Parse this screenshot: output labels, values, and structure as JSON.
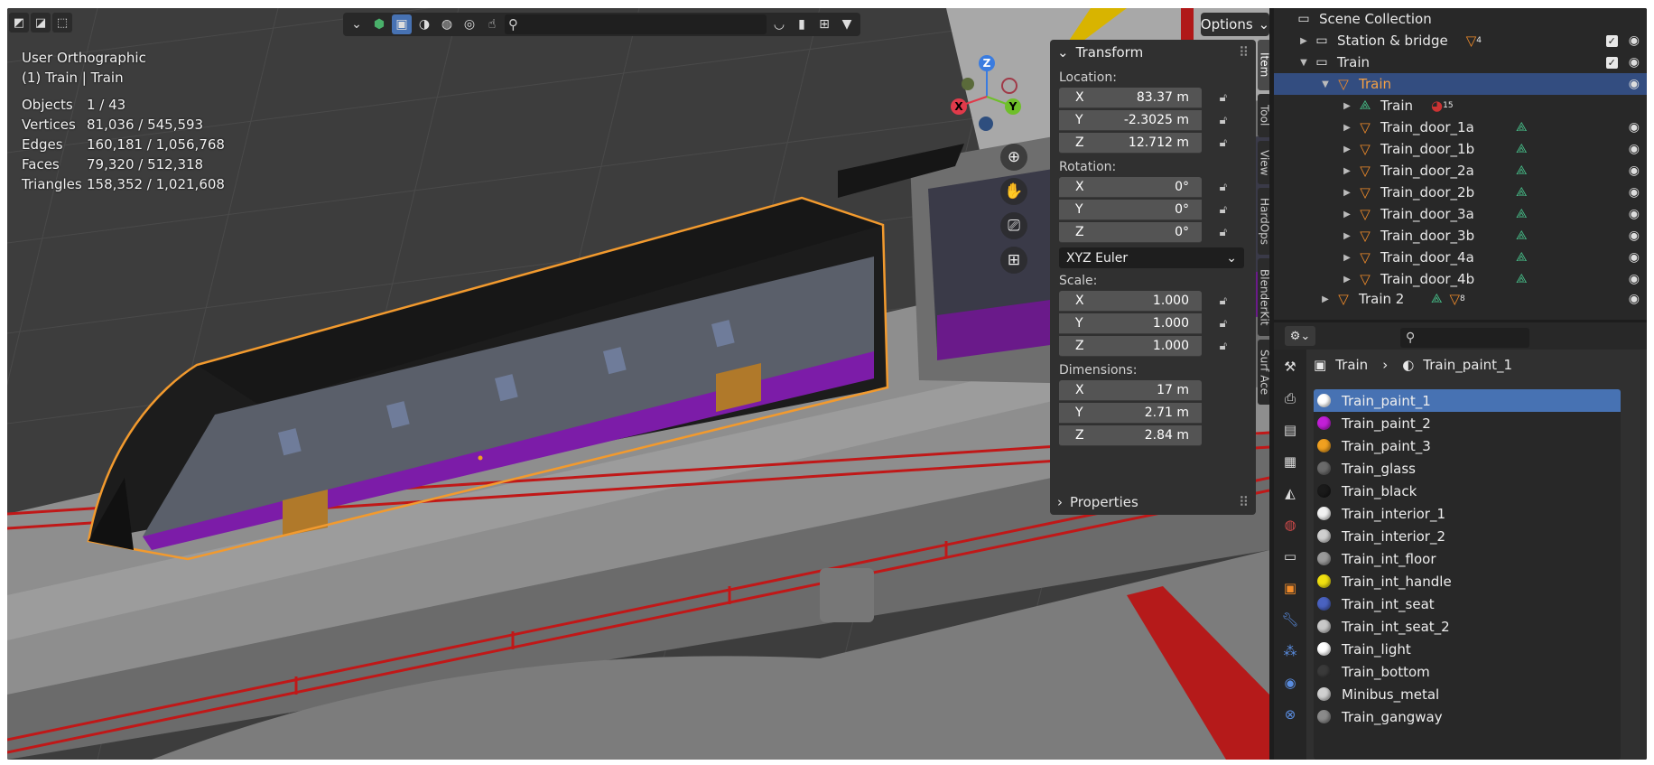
{
  "viewport": {
    "view_name": "User Orthographic",
    "active_object": "(1) Train | Train",
    "stats": [
      {
        "label": "Objects",
        "value": "1 / 43"
      },
      {
        "label": "Vertices",
        "value": "81,036 / 545,593"
      },
      {
        "label": "Edges",
        "value": "160,181 / 1,056,768"
      },
      {
        "label": "Faces",
        "value": "79,320 / 512,318"
      },
      {
        "label": "Triangles",
        "value": "158,352 / 1,021,608"
      }
    ],
    "options_label": "Options",
    "gizmo": {
      "x": "X",
      "y": "Y",
      "z": "Z"
    }
  },
  "npanel": {
    "transform_title": "Transform",
    "location_label": "Location:",
    "location": [
      {
        "axis": "X",
        "value": "83.37 m"
      },
      {
        "axis": "Y",
        "value": "-2.3025 m"
      },
      {
        "axis": "Z",
        "value": "12.712 m"
      }
    ],
    "rotation_label": "Rotation:",
    "rotation": [
      {
        "axis": "X",
        "value": "0°"
      },
      {
        "axis": "Y",
        "value": "0°"
      },
      {
        "axis": "Z",
        "value": "0°"
      }
    ],
    "rotation_mode": "XYZ Euler",
    "scale_label": "Scale:",
    "scale": [
      {
        "axis": "X",
        "value": "1.000"
      },
      {
        "axis": "Y",
        "value": "1.000"
      },
      {
        "axis": "Z",
        "value": "1.000"
      }
    ],
    "dimensions_label": "Dimensions:",
    "dimensions": [
      {
        "axis": "X",
        "value": "17 m"
      },
      {
        "axis": "Y",
        "value": "2.71 m"
      },
      {
        "axis": "Z",
        "value": "2.84 m"
      }
    ],
    "properties_title": "Properties",
    "tabs": [
      "Item",
      "Tool",
      "View",
      "HardOps",
      "BlenderKit",
      "Surf Ace"
    ]
  },
  "outliner": {
    "scene_collection": "Scene Collection",
    "rows": [
      {
        "label": "Station & bridge",
        "badge": "4"
      },
      {
        "label": "Train"
      },
      {
        "label": "Train"
      },
      {
        "label": "Train",
        "badge": "15"
      },
      {
        "label": "Train_door_1a"
      },
      {
        "label": "Train_door_1b"
      },
      {
        "label": "Train_door_2a"
      },
      {
        "label": "Train_door_2b"
      },
      {
        "label": "Train_door_3a"
      },
      {
        "label": "Train_door_3b"
      },
      {
        "label": "Train_door_4a"
      },
      {
        "label": "Train_door_4b"
      },
      {
        "label": "Train 2",
        "badge": "8"
      }
    ]
  },
  "properties": {
    "breadcrumb_object": "Train",
    "breadcrumb_material": "Train_paint_1",
    "materials": [
      {
        "name": "Train_paint_1",
        "color": "#ffffff"
      },
      {
        "name": "Train_paint_2",
        "color": "#c21fd8"
      },
      {
        "name": "Train_paint_3",
        "color": "#f0a020"
      },
      {
        "name": "Train_glass",
        "color": "#6a6a6a"
      },
      {
        "name": "Train_black",
        "color": "#1a1a1a"
      },
      {
        "name": "Train_interior_1",
        "color": "#f2f2f2"
      },
      {
        "name": "Train_interior_2",
        "color": "#cfcfcf"
      },
      {
        "name": "Train_int_floor",
        "color": "#9a9a9a"
      },
      {
        "name": "Train_int_handle",
        "color": "#f0e010"
      },
      {
        "name": "Train_int_seat",
        "color": "#4a62c0"
      },
      {
        "name": "Train_int_seat_2",
        "color": "#c8c8c8"
      },
      {
        "name": "Train_light",
        "color": "#ffffff"
      },
      {
        "name": "Train_bottom",
        "color": "#3a3a3a"
      },
      {
        "name": "Minibus_metal",
        "color": "#d0d0d0"
      },
      {
        "name": "Train_gangway",
        "color": "#8a8a8a"
      }
    ]
  }
}
